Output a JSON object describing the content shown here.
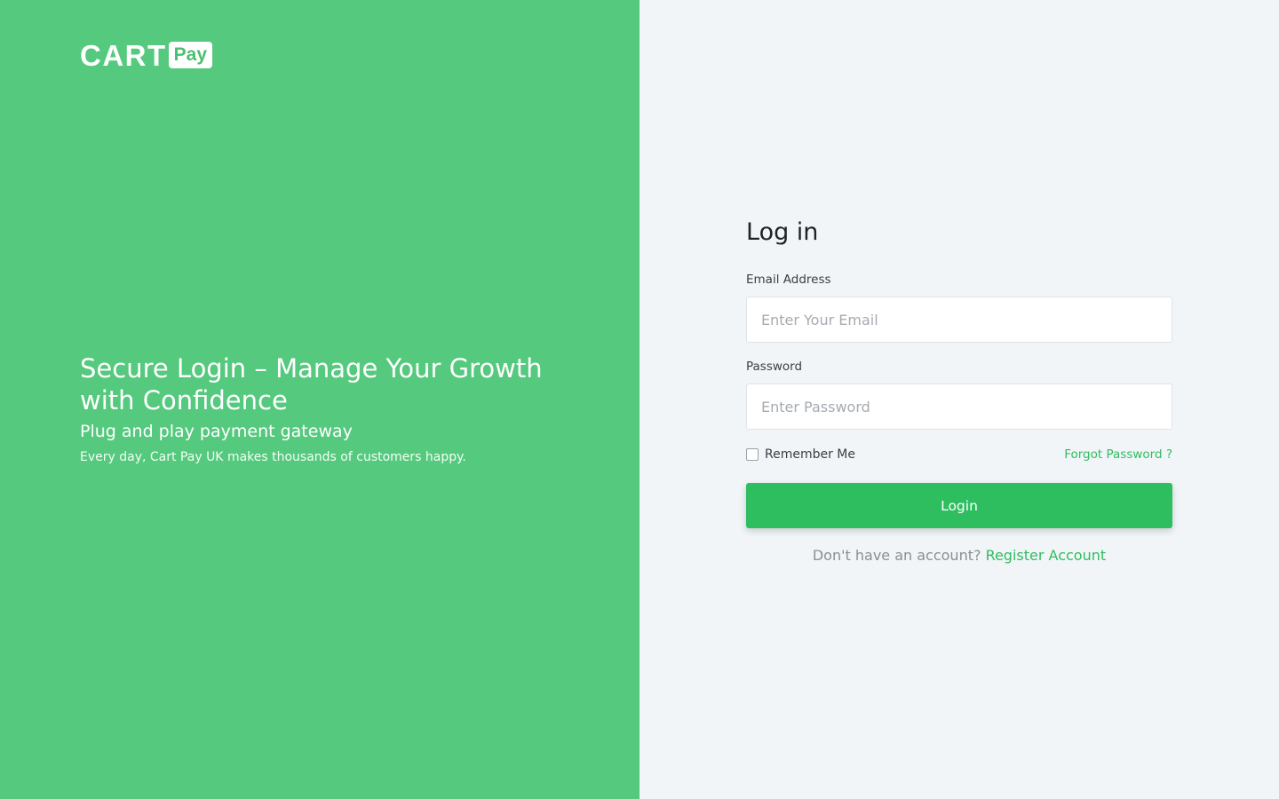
{
  "brand": {
    "logo_word": "CART",
    "logo_badge": "Pay"
  },
  "hero": {
    "title": "Secure Login – Manage Your Growth with Confidence",
    "subtitle": "Plug and play payment gateway",
    "description": "Every day, Cart Pay UK makes thousands of customers happy."
  },
  "login_form": {
    "title": "Log in",
    "email_label": "Email Address",
    "email_placeholder": "Enter Your Email",
    "email_value": "",
    "password_label": "Password",
    "password_placeholder": "Enter Password",
    "password_value": "",
    "remember_label": "Remember Me",
    "remember_checked": false,
    "forgot_link": "Forgot Password ?",
    "submit_label": "Login",
    "register_prompt": "Don't have an account?",
    "register_link": "Register Account"
  },
  "colors": {
    "brand_green": "#55c97d",
    "accent_green": "#2ebe60",
    "form_background": "#f1f5f8"
  }
}
